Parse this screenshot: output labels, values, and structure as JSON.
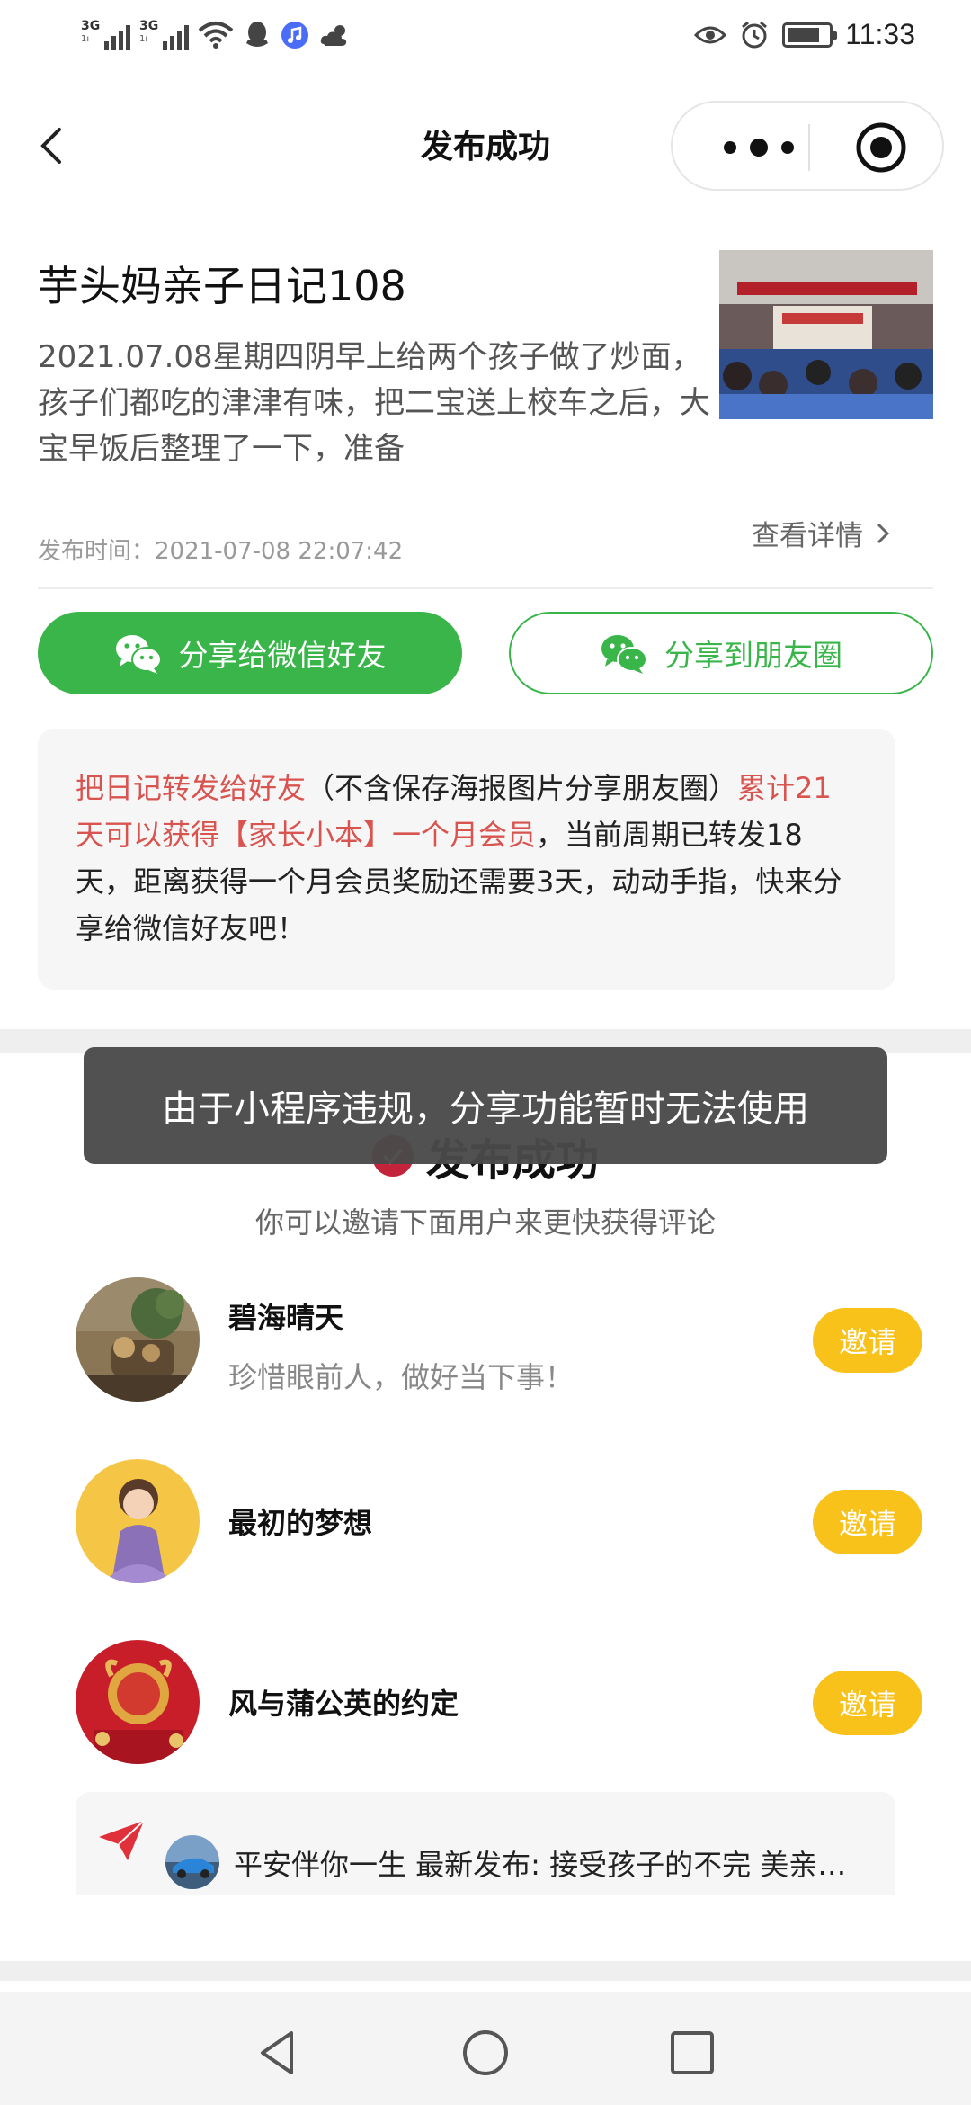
{
  "status_bar": {
    "network1": "3G",
    "network2": "3G",
    "time": "11:33",
    "battery_level": 0.8,
    "icons": [
      "signal-icon",
      "wifi-icon",
      "qq-icon",
      "music-icon",
      "weather-icon",
      "eye-icon",
      "alarm-icon",
      "battery-icon"
    ]
  },
  "navbar": {
    "title": "发布成功"
  },
  "article": {
    "title": "芋头妈亲子日记108",
    "excerpt": "2021.07.08星期四阴早上给两个孩子做了炒面，孩子们都吃的津津有味，把二宝送上校车之后，大宝早饭后整理了一下，准备",
    "publish_time": "发布时间：2021-07-08 22:07:42",
    "detail_link": "查看详情"
  },
  "share": {
    "friend_label": "分享给微信好友",
    "moments_label": "分享到朋友圈"
  },
  "notice": {
    "part1": "把日记转发给好友",
    "part2": "（不含保存海报图片分享朋友圈）",
    "part3": "累计21天可以获得【家长小本】一个月会员",
    "part4": "，当前周期已转发18天，距离获得一个月会员奖励还需要3天，动动手指，快来分享给微信好友吧！"
  },
  "success": {
    "title": "发布成功",
    "hint": "你可以邀请下面用户来更快获得评论"
  },
  "users": [
    {
      "name": "碧海晴天",
      "signature": "珍惜眼前人，做好当下事！",
      "button": "邀请"
    },
    {
      "name": "最初的梦想",
      "signature": "",
      "button": "邀请"
    },
    {
      "name": "风与蒲公英的约定",
      "signature": "",
      "button": "邀请"
    }
  ],
  "feed": {
    "text": "平安伴你一生 最新发布: 接受孩子的不完 美亲…"
  },
  "toast": {
    "text": "由于小程序违规，分享功能暂时无法使用"
  },
  "colors": {
    "wechat_green": "#39b54a",
    "invite_yellow": "#f9c21a",
    "highlight_red": "#d9534f",
    "check_red": "#c4243b"
  }
}
